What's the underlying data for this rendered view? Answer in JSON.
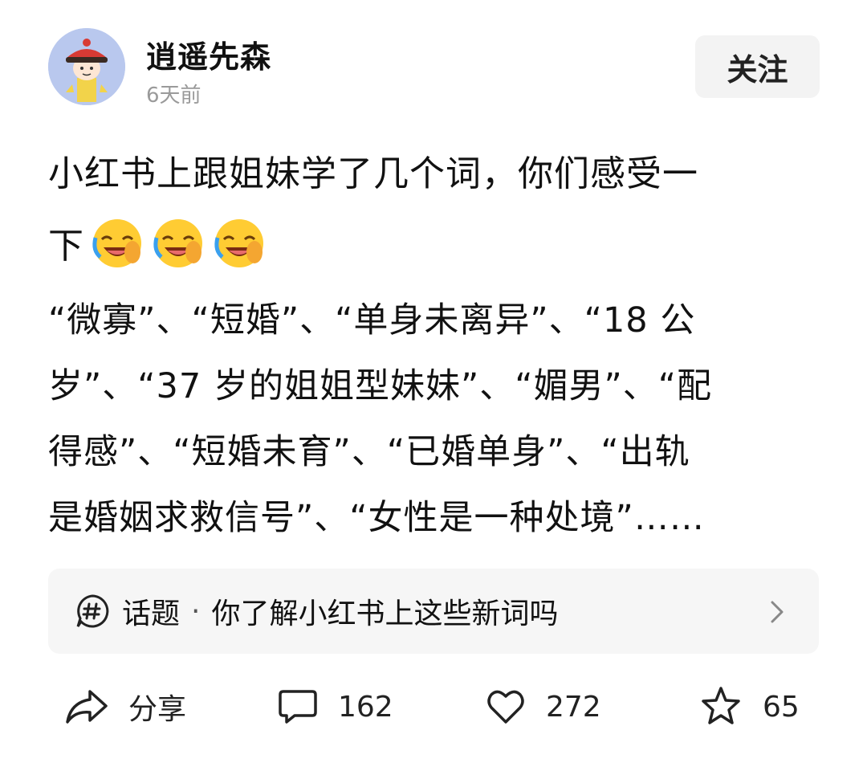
{
  "post": {
    "author": "逍遥先森",
    "time": "6天前",
    "follow_label": "关注",
    "title_lines": [
      "小红书上跟姐妹学了几个词，你们感受一",
      "下"
    ],
    "emoji": "laughing-crying-face",
    "body_lines": [
      "“微寡”、“短婚”、“单身未离异”、“18 公",
      "岁”、“37 岁的姐姐型妹妹”、“媚男”、“配",
      "得感”、“短婚未育”、“已婚单身”、“出轨",
      "是婚姻求救信号”、“女性是一种处境”……"
    ]
  },
  "topic": {
    "label": "话题",
    "separator": "·",
    "title": "你了解小红书上这些新词吗"
  },
  "actions": {
    "share_label": "分享",
    "comments": "162",
    "likes": "272",
    "favorites": "65"
  },
  "colors": {
    "text": "#111111",
    "muted": "#9a9a9a",
    "card_bg": "#f6f6f6",
    "button_bg": "#f3f3f3",
    "avatar_bg": "#b9c8ee"
  }
}
